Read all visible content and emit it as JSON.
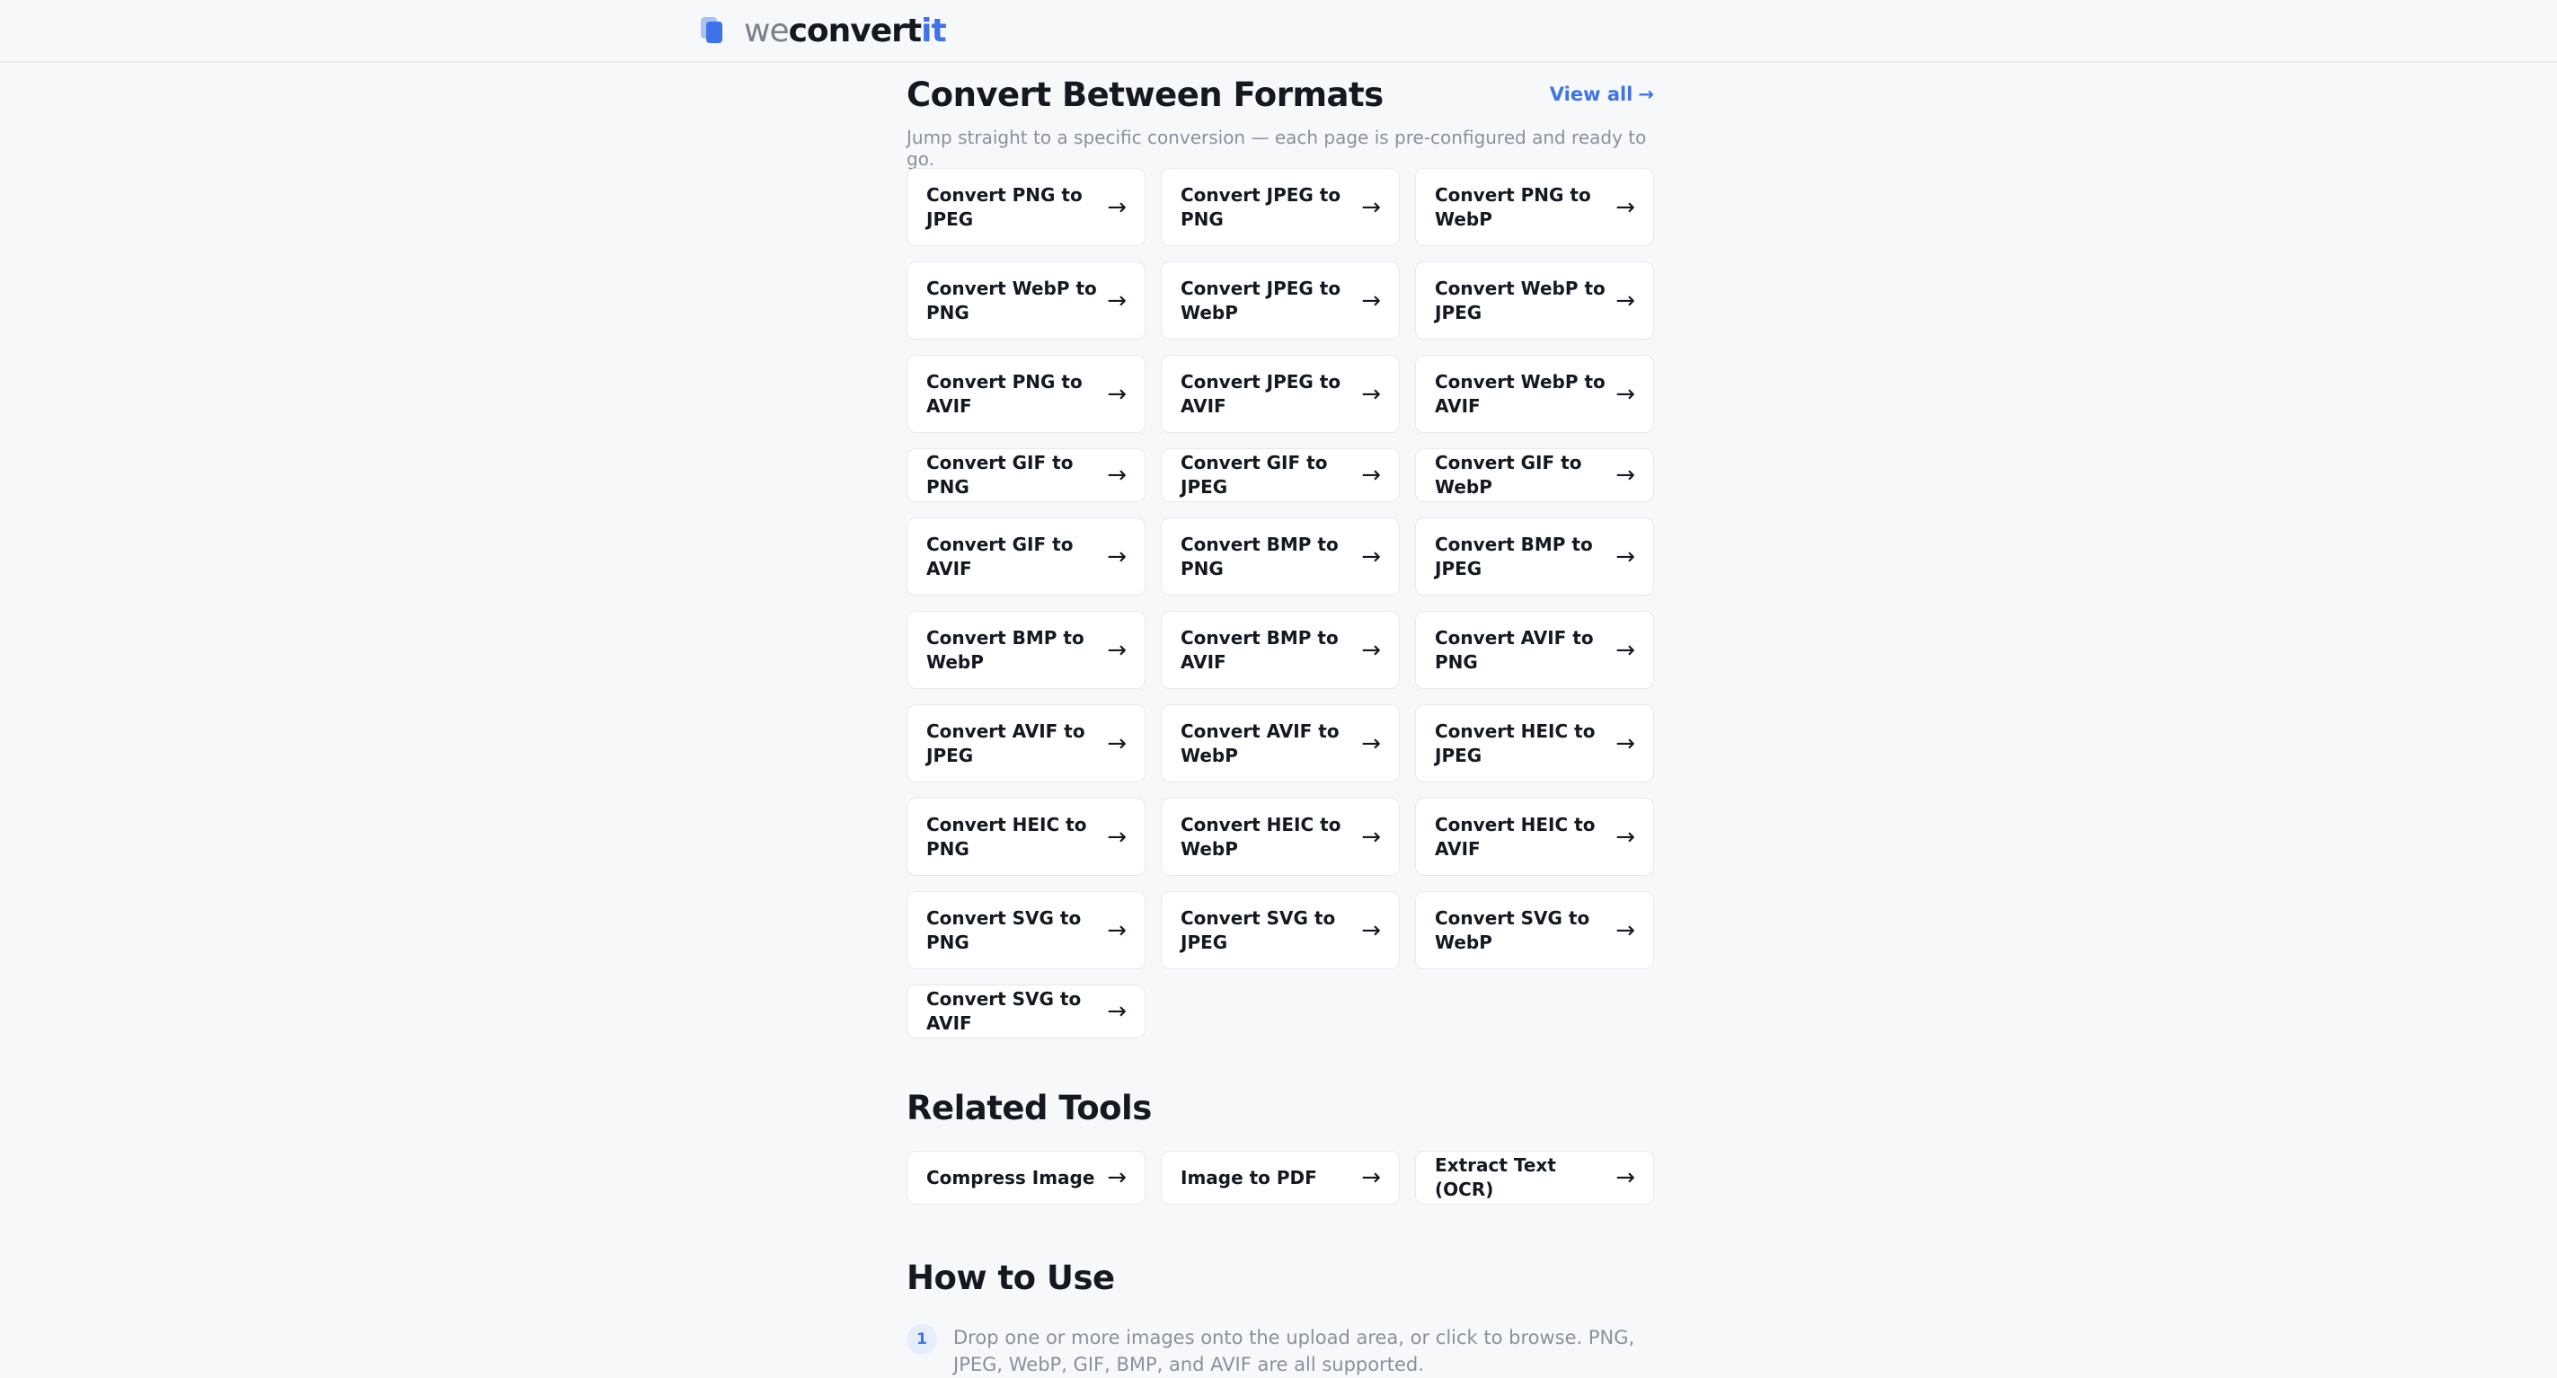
{
  "brand": {
    "part1": "we",
    "part2": "convert",
    "part3": "it"
  },
  "formats": {
    "title": "Convert Between Formats",
    "view_all": "View all",
    "view_all_arrow": "→",
    "subtitle": "Jump straight to a specific conversion — each page is pre-configured and ready to go.",
    "items": [
      "Convert PNG to JPEG",
      "Convert JPEG to PNG",
      "Convert PNG to WebP",
      "Convert WebP to PNG",
      "Convert JPEG to WebP",
      "Convert WebP to JPEG",
      "Convert PNG to AVIF",
      "Convert JPEG to AVIF",
      "Convert WebP to AVIF",
      "Convert GIF to PNG",
      "Convert GIF to JPEG",
      "Convert GIF to WebP",
      "Convert GIF to AVIF",
      "Convert BMP to PNG",
      "Convert BMP to JPEG",
      "Convert BMP to WebP",
      "Convert BMP to AVIF",
      "Convert AVIF to PNG",
      "Convert AVIF to JPEG",
      "Convert AVIF to WebP",
      "Convert HEIC to JPEG",
      "Convert HEIC to PNG",
      "Convert HEIC to WebP",
      "Convert HEIC to AVIF",
      "Convert SVG to PNG",
      "Convert SVG to JPEG",
      "Convert SVG to WebP",
      "Convert SVG to AVIF"
    ]
  },
  "related": {
    "title": "Related Tools",
    "items": [
      "Compress Image",
      "Image to PDF",
      "Extract Text (OCR)"
    ]
  },
  "how_to": {
    "title": "How to Use",
    "steps": [
      {
        "num": "1",
        "text": "Drop one or more images onto the upload area, or click to browse. PNG, JPEG, WebP, GIF, BMP, and AVIF are all supported."
      }
    ]
  },
  "card_arrow": "→",
  "colors": {
    "accent": "#3e73ea",
    "background": "#f7f8fa",
    "card": "#ffffff",
    "muted_text": "#8a909c"
  }
}
